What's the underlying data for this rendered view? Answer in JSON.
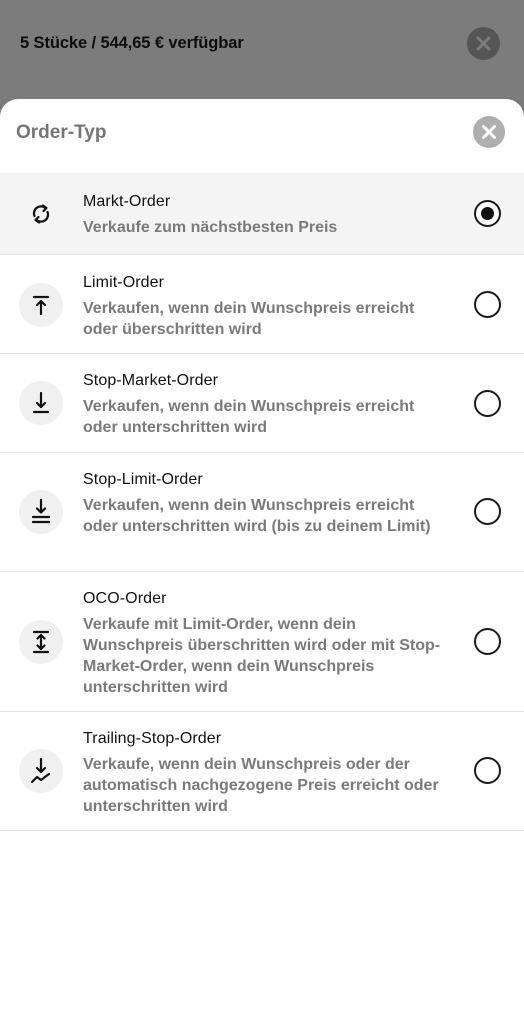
{
  "header": {
    "availability": "5 Stücke / 544,65 € verfügbar"
  },
  "sheet": {
    "title": "Order-Typ"
  },
  "options": [
    {
      "title": "Markt-Order",
      "description": "Verkaufe zum nächstbesten Preis",
      "icon": "refresh-icon",
      "selected": true
    },
    {
      "title": "Limit-Order",
      "description": "Verkaufen, wenn dein Wunschpreis erreicht oder überschritten wird",
      "icon": "arrow-up-to-line-icon",
      "selected": false
    },
    {
      "title": "Stop-Market-Order",
      "description": "Verkaufen, wenn dein Wunschpreis erreicht oder unterschritten wird",
      "icon": "arrow-down-to-line-icon",
      "selected": false
    },
    {
      "title": "Stop-Limit-Order",
      "description": "Verkaufen, wenn dein Wunschpreis erreicht oder unterschritten wird (bis zu deinem Limit)",
      "icon": "arrow-down-to-double-line-icon",
      "selected": false
    },
    {
      "title": "OCO-Order",
      "description": "Verkaufe mit Limit-Order, wenn dein Wunschpreis überschritten wird oder mit Stop-Market-Order, wenn dein Wunschpreis unterschritten wird",
      "icon": "arrows-between-lines-icon",
      "selected": false
    },
    {
      "title": "Trailing-Stop-Order",
      "description": "Verkaufe, wenn dein Wunschpreis oder der automatisch nachgezogene Preis erreicht oder unterschritten wird",
      "icon": "arrow-down-trailing-icon",
      "selected": false
    }
  ]
}
